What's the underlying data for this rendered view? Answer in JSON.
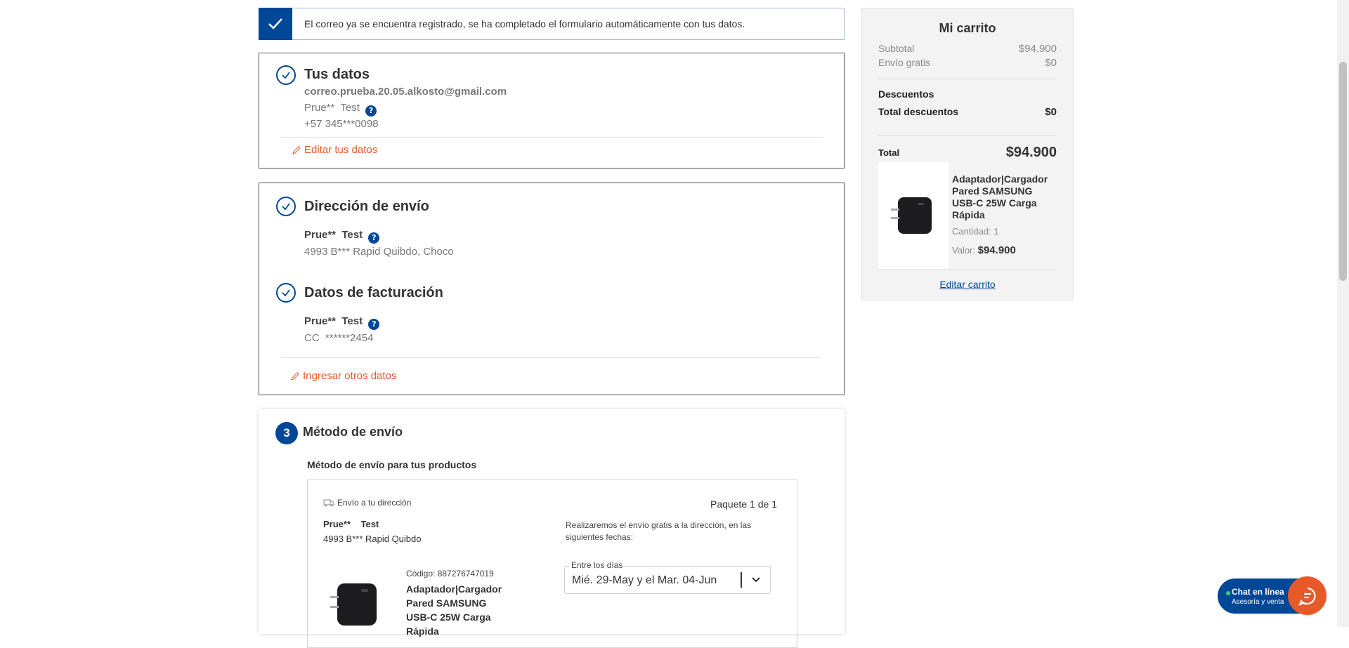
{
  "notice": {
    "text": "El correo ya se encuentra registrado, se ha completado el formulario automáticamente con tus datos."
  },
  "personal": {
    "title": "Tus datos",
    "email": "correo.prueba.20.05.alkosto@gmail.com",
    "name_first": "Prue**",
    "name_last": "Test",
    "help_glyph": "?",
    "phone": "+57 345***0098",
    "edit_label": "Editar tus datos"
  },
  "shipping_address": {
    "title": "Dirección de envío",
    "name_first": "Prue**",
    "name_last": "Test",
    "address": "4993 B*** Rapid Quibdo, Choco"
  },
  "billing": {
    "title": "Datos de facturación",
    "name_first": "Prue**",
    "name_last": "Test",
    "doc_type": "CC",
    "doc_number": "******2454",
    "other_label": "Ingresar otros datos"
  },
  "shipping_method": {
    "step_number": "3",
    "title": "Método de envío",
    "subtitle": "Método de envío para tus productos",
    "delivery_label": "Envío a tu dirección",
    "package_label": "Paquete 1 de 1",
    "recipient_first": "Prue**",
    "recipient_last": "Test",
    "recipient_address": "4993 B*** Rapid  Quibdo",
    "info_text": "Realizaremos el envío gratis a la dirección, en las siguientes fechas:",
    "dates_legend": "Entre los días",
    "dates_value": "Mié. 29-May y el Mar. 04-Jun",
    "product_code": "Código: 887276747019",
    "product_name": "Adaptador|Cargador Pared SAMSUNG USB-C 25W Carga Rápida"
  },
  "cart": {
    "title": "Mi carrito",
    "subtotal_label": "Subtotal",
    "subtotal_value": "$94.900",
    "shipping_label": "Envío gratis",
    "shipping_value": "$0",
    "discounts_label": "Descuentos",
    "total_discounts_label": "Total descuentos",
    "total_discounts_value": "$0",
    "total_label": "Total",
    "total_value": "$94.900",
    "product_name": "Adaptador|Cargador Pared SAMSUNG USB-C 25W Carga Rápida",
    "quantity": "Cantidad: 1",
    "price_label": "Valor:",
    "price_value": "$94.900",
    "edit_label": "Editar carrito"
  },
  "chat": {
    "title": "Chat en línea",
    "subtitle": "Asesoría y venta"
  },
  "colors": {
    "brand_blue": "#004797",
    "accent_orange": "#e8592a",
    "online_green": "#3ecf6a"
  }
}
